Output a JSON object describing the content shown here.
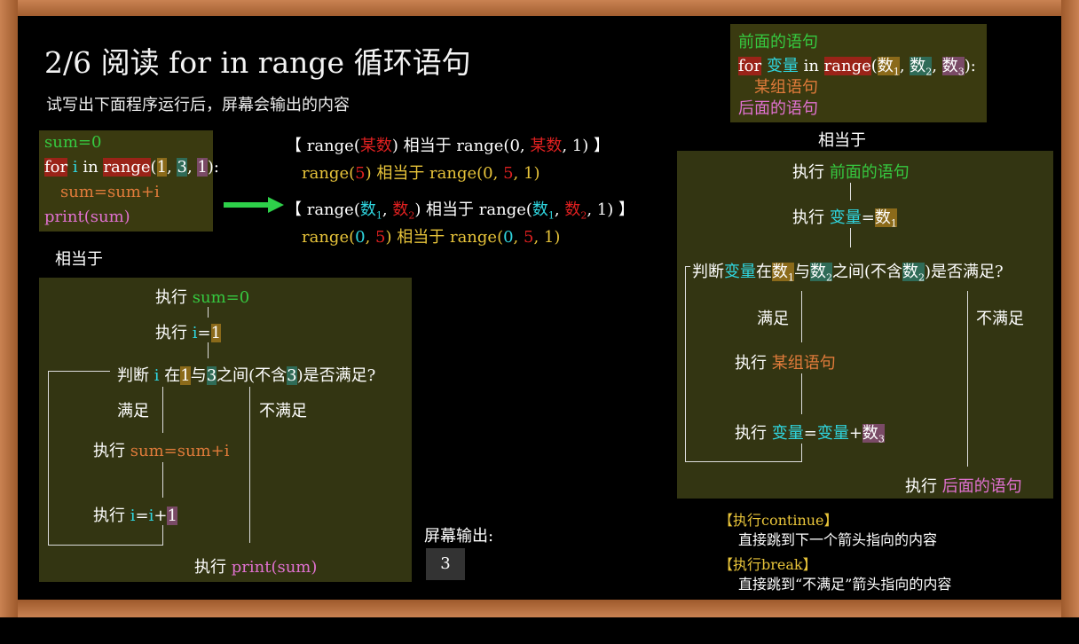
{
  "title": "2/6 阅读 for in range 循环语句",
  "subtitle": "试写出下面程序运行后，屏幕会输出的内容",
  "code": {
    "line1": "sum=0",
    "for_kw": "for",
    "var": "i",
    "in_kw": "in",
    "range_kw": "range",
    "arg1": "1",
    "arg2": "3",
    "arg3": "1",
    "line3": "sum=sum+i",
    "line4": "print(sum)"
  },
  "equivalent_label": "相当于",
  "range_rules": {
    "rule1_a": "【 range(",
    "rule1_arg": "某数",
    "rule1_b": ") 相当于 range(0, ",
    "rule1_arg2": "某数",
    "rule1_c": ", 1) 】",
    "example1_a": "range(",
    "example1_n": "5",
    "example1_b": ") 相当于 range(0, ",
    "example1_n2": "5",
    "example1_c": ", 1)",
    "rule2_a": "【 range(",
    "rule2_b": ") 相当于 range(",
    "rule2_c": ", 1) 】",
    "num": "数",
    "sub1": "1",
    "sub2": "2",
    "sub3": "3",
    "example2_a": "range(",
    "example2_n0": "0",
    "example2_n5": "5",
    "example2_b": ") 相当于 range(",
    "example2_c": ", 1)"
  },
  "left_flow": {
    "exec": "执行",
    "init": "sum=0",
    "set_i": "i",
    "eq": "=",
    "one": "1",
    "judge_a": "判断",
    "judge_i": "i",
    "judge_b": "在",
    "judge_n1": "1",
    "judge_c": "与",
    "judge_n3": "3",
    "judge_d": "之间(不含",
    "judge_n3b": "3",
    "judge_e": ")是否满足?",
    "satisfied": "满足",
    "not_satisfied": "不满足",
    "body": "sum=sum+i",
    "incr_a": "i",
    "incr_b": "=",
    "incr_c": "i",
    "incr_d": "+",
    "incr_e": "1",
    "print": "print(sum)"
  },
  "output_label": "屏幕输出:",
  "output_value": "3",
  "generic_code": {
    "before": "前面的语句",
    "for_kw": "for",
    "var": "变量",
    "in_kw": "in",
    "range_kw": "range",
    "num": "数",
    "body": "某组语句",
    "after": "后面的语句"
  },
  "right_flow": {
    "exec": "执行",
    "before": "前面的语句",
    "var": "变量",
    "eq": "=",
    "num": "数",
    "judge_a": "判断",
    "judge_b": "在",
    "judge_c": "与",
    "judge_d": "之间(不含",
    "judge_e": ")是否满足?",
    "satisfied": "满足",
    "not_satisfied": "不满足",
    "body": "某组语句",
    "plus": "+",
    "after": "后面的语句"
  },
  "notes": {
    "continue_title": "【执行continue】",
    "continue_desc": "直接跳到下一个箭头指向的内容",
    "break_title": "【执行break】",
    "break_desc": "直接跳到“不满足”箭头指向的内容"
  }
}
